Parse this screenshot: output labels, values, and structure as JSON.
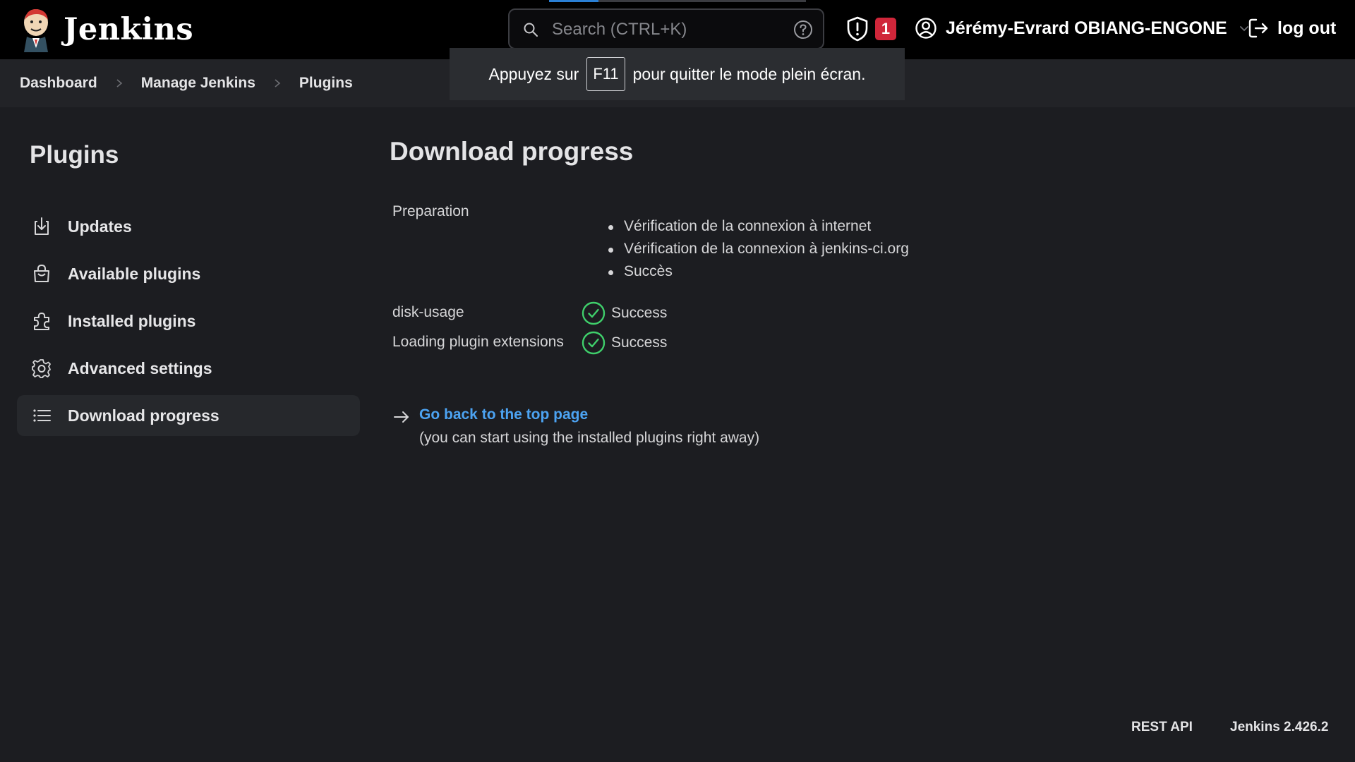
{
  "header": {
    "brand_name": "Jenkins",
    "search_placeholder": "Search (CTRL+K)",
    "security_count": "1",
    "user_name": "Jérémy-Evrard OBIANG-ENGONE",
    "logout_label": "log out"
  },
  "fullscreen_notice": {
    "before": "Appuyez sur",
    "key": "F11",
    "after": "pour quitter le mode plein écran."
  },
  "breadcrumb": [
    "Dashboard",
    "Manage Jenkins",
    "Plugins"
  ],
  "sidebar": {
    "title": "Plugins",
    "items": [
      {
        "label": "Updates",
        "icon": "download-icon"
      },
      {
        "label": "Available plugins",
        "icon": "shopping-bag-icon"
      },
      {
        "label": "Installed plugins",
        "icon": "puzzle-icon"
      },
      {
        "label": "Advanced settings",
        "icon": "gear-icon"
      },
      {
        "label": "Download progress",
        "icon": "list-icon",
        "active": true
      }
    ]
  },
  "main": {
    "title": "Download progress",
    "preparation": {
      "label": "Preparation",
      "steps": [
        "Vérification de la connexion à internet",
        "Vérification de la connexion à jenkins-ci.org",
        "Succès"
      ]
    },
    "jobs": [
      {
        "name": "disk-usage",
        "status": "Success"
      },
      {
        "name": "Loading plugin extensions",
        "status": "Success"
      }
    ],
    "back_link": "Go back to the top page",
    "back_note": "(you can start using the installed plugins right away)"
  },
  "footer": {
    "rest_api": "REST API",
    "version": "Jenkins 2.426.2"
  },
  "colors": {
    "header_bg": "#000000",
    "page_bg": "#1c1d21",
    "link": "#4ca3f2",
    "success": "#3fcf6b",
    "badge": "#d0263a"
  }
}
